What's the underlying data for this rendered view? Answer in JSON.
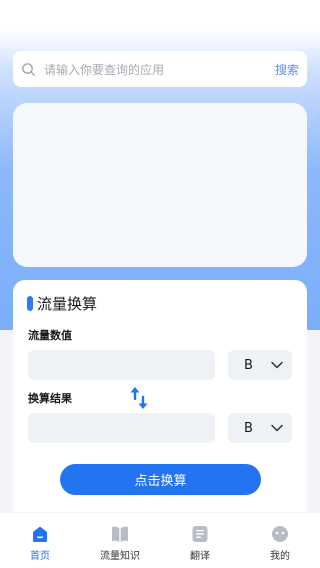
{
  "search": {
    "placeholder": "请输入你要查询的应用",
    "button_label": "搜索"
  },
  "converter": {
    "title": "流量换算",
    "input_label": "流量数值",
    "input_value": "",
    "input_unit": "B",
    "result_label": "换算结果",
    "result_value": "",
    "result_unit": "B",
    "convert_label": "点击换算"
  },
  "tabbar": {
    "active_index": 0,
    "items": [
      {
        "label": "首页",
        "icon": "home-icon"
      },
      {
        "label": "流量知识",
        "icon": "book-icon"
      },
      {
        "label": "翻译",
        "icon": "translate-icon"
      },
      {
        "label": "我的",
        "icon": "profile-icon"
      }
    ]
  },
  "colors": {
    "accent": "#2274f1",
    "search_button": "#5b8ef0",
    "gradient_bottom": "#7aaef9",
    "field_bg": "#eef1f6"
  }
}
